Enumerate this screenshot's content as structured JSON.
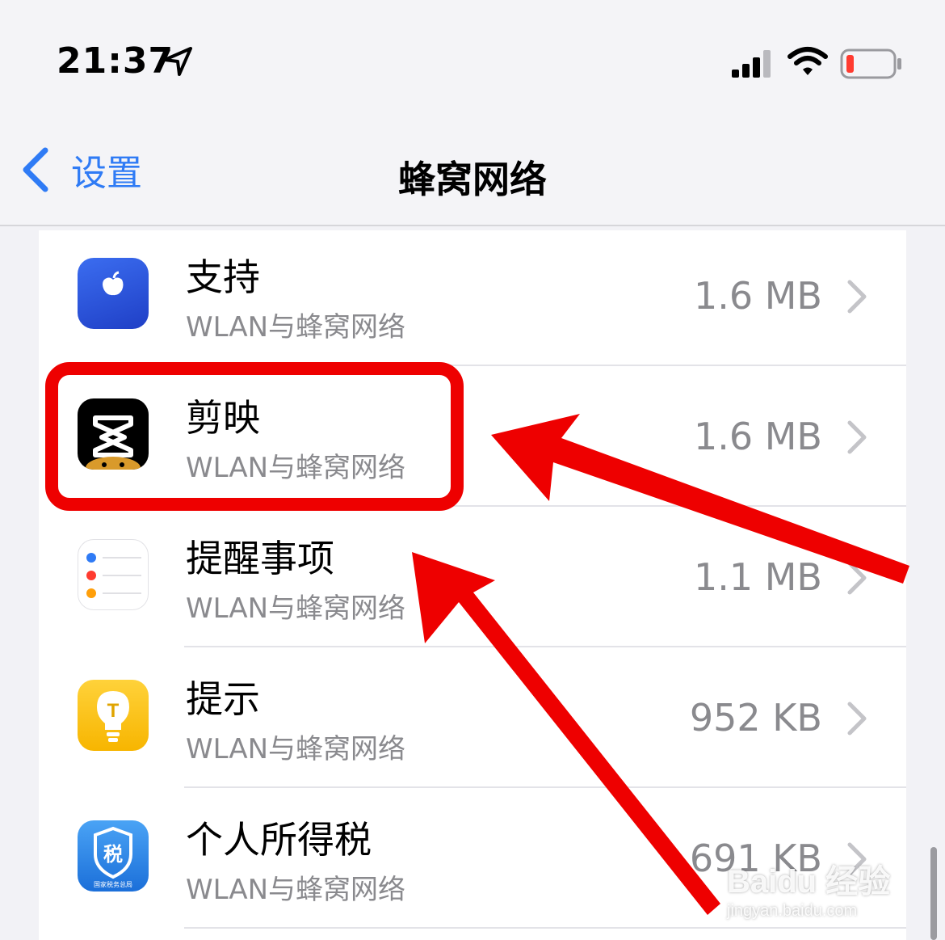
{
  "status_bar": {
    "time": "21:37",
    "signal_bars": 4,
    "battery_color": "#ff3b30"
  },
  "nav": {
    "back_label": "设置",
    "title": "蜂窝网络",
    "accent": "#2f7bf5"
  },
  "rows": [
    {
      "name": "支持",
      "subtitle": "WLAN与蜂窝网络",
      "usage": "1.6 MB",
      "icon": "apple-support-icon"
    },
    {
      "name": "剪映",
      "subtitle": "WLAN与蜂窝网络",
      "usage": "1.6 MB",
      "icon": "capcut-icon"
    },
    {
      "name": "提醒事项",
      "subtitle": "WLAN与蜂窝网络",
      "usage": "1.1 MB",
      "icon": "reminders-icon"
    },
    {
      "name": "提示",
      "subtitle": "WLAN与蜂窝网络",
      "usage": "952 KB",
      "icon": "tips-icon"
    },
    {
      "name": "个人所得税",
      "subtitle": "WLAN与蜂窝网络",
      "usage": "691 KB",
      "icon": "tax-app-icon"
    }
  ],
  "tax_icon_char": "税",
  "tax_icon_caption": "国家税务总局",
  "tips_icon_char": "T",
  "annotation_color": "#ee0000",
  "watermark": {
    "line1": "Baidu 经验",
    "line2": "jingyan.baidu.com"
  }
}
